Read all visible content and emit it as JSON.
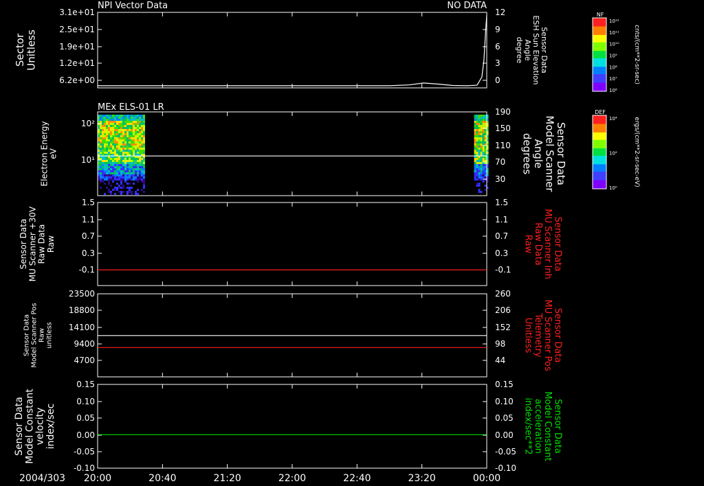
{
  "header": {
    "left_title": "NPI Vector Data",
    "right_title": "NO DATA"
  },
  "colors": {
    "white": "#ffffff",
    "red": "#ff2020",
    "green": "#00e000",
    "background": "#000000"
  },
  "colorbars": [
    {
      "tag": "NF",
      "ticks": [
        "10¹²",
        "10¹¹",
        "10¹⁰",
        "10⁹",
        "10⁸",
        "10⁷",
        "10⁶"
      ],
      "label": "cnts/(cm**2-sr-sec)"
    },
    {
      "tag": "DEF",
      "ticks": [
        "10⁴",
        "10²",
        "10⁰"
      ],
      "label": "ergs/(cm**2-sr-sec-eV)"
    }
  ],
  "chart_data": [
    {
      "type": "line",
      "title": "NPI Vector Data",
      "status": "NO DATA",
      "left_axis": {
        "label_lines": [
          "Sector",
          "Unitless"
        ],
        "ticks": [
          "3.1e+01",
          "2.5e+01",
          "1.9e+01",
          "1.2e+01",
          "6.2e+00"
        ],
        "ylim": [
          0,
          31
        ]
      },
      "right_axis": {
        "label_lines": [
          "Sensor Data",
          "ESH Sun Elevation",
          "Angle",
          "degree"
        ],
        "ticks": [
          "12",
          "9",
          "6",
          "3",
          "0"
        ],
        "ylim": [
          -2,
          12
        ]
      },
      "series": [
        {
          "axis": "right",
          "color": "#ffffff",
          "x": [
            0,
            3.0,
            3.2,
            3.35,
            3.5,
            3.65,
            3.8,
            3.9,
            3.95,
            3.97,
            3.99,
            4.0
          ],
          "y": [
            -1.6,
            -1.6,
            -1.45,
            -1.1,
            -1.3,
            -1.55,
            -1.6,
            -1.5,
            0,
            3,
            9,
            11.5
          ]
        }
      ]
    },
    {
      "type": "heatmap",
      "title": "MEx ELS-01 LR",
      "left_axis": {
        "label_lines": [
          "Electron Energy",
          "eV"
        ],
        "scale": "log",
        "ticks": [
          "10²",
          "10¹"
        ],
        "ylim": [
          1,
          200
        ]
      },
      "right_axis": {
        "label_lines": [
          "Sensor Data",
          "Model Scanner",
          "Angle",
          "degrees"
        ],
        "ticks": [
          "190",
          "150",
          "110",
          "70",
          "30"
        ],
        "ylim": [
          0,
          190
        ]
      },
      "data_blocks": [
        {
          "x_start": 0.0,
          "x_end": 0.48
        },
        {
          "x_start": 3.87,
          "x_end": 4.0
        }
      ],
      "series": [
        {
          "axis": "right",
          "color": "#ffffff",
          "x": [
            0,
            4
          ],
          "y": [
            90,
            90
          ]
        }
      ]
    },
    {
      "type": "line",
      "left_axis": {
        "label_lines": [
          "Sensor Data",
          "MU Scanner +30V",
          "Raw Data",
          "Raw"
        ],
        "ticks": [
          "1.5",
          "1.1",
          "0.7",
          "0.3",
          "-0.1"
        ],
        "ylim": [
          -0.35,
          1.5
        ]
      },
      "right_axis": {
        "label_lines": [
          "Sensor Data",
          "MU Scanner Inh",
          "Raw Data",
          "Raw"
        ],
        "ticks": [
          "1.5",
          "1.1",
          "0.7",
          "0.3",
          "-0.1"
        ],
        "ylim": [
          -0.35,
          1.5
        ]
      },
      "series": [
        {
          "axis": "left",
          "color": "#ff2020",
          "x": [
            0,
            4
          ],
          "y": [
            0.0,
            0.0
          ]
        }
      ]
    },
    {
      "type": "line",
      "left_axis": {
        "label_lines": [
          "Sensor Data",
          "Model Scanner Pos",
          "Raw",
          "unitless"
        ],
        "ticks": [
          "23500",
          "18800",
          "14100",
          "9400",
          "4700"
        ],
        "ylim": [
          0,
          23500
        ]
      },
      "right_axis": {
        "label_lines": [
          "Sensor Data",
          "MU Scanner Pos",
          "Telemetry",
          "Unitless"
        ],
        "ticks": [
          "260",
          "206",
          "152",
          "98",
          "44"
        ],
        "ylim": [
          -10,
          260
        ]
      },
      "series": [
        {
          "axis": "left",
          "color": "#ffffff",
          "x": [
            0,
            4
          ],
          "y": [
            11700,
            11700
          ]
        },
        {
          "axis": "left",
          "color": "#ff2020",
          "x": [
            0,
            4
          ],
          "y": [
            8300,
            8300
          ]
        }
      ]
    },
    {
      "type": "line",
      "left_axis": {
        "label_lines": [
          "Sensor Data",
          "Model Constant",
          "velocity",
          "index/sec"
        ],
        "ticks": [
          "0.15",
          "0.10",
          "0.05",
          "0.00",
          "-0.05",
          "-0.10"
        ],
        "ylim": [
          -0.1,
          0.15
        ]
      },
      "right_axis": {
        "label_lines": [
          "Sensor Data",
          "Model Constant",
          "acceleration",
          "index/sec**2"
        ],
        "ticks": [
          "0.15",
          "0.10",
          "0.05",
          "0.00",
          "-0.05",
          "-0.10"
        ],
        "ylim": [
          -0.1,
          0.15
        ]
      },
      "series": [
        {
          "axis": "left",
          "color": "#00e000",
          "x": [
            0,
            4
          ],
          "y": [
            0.0,
            0.0
          ]
        }
      ]
    }
  ],
  "x_axis": {
    "date_label": "2004/303",
    "ticks": [
      "20:00",
      "20:40",
      "21:20",
      "22:00",
      "22:40",
      "23:20",
      "00:00"
    ],
    "tick_hours": [
      0,
      0.6667,
      1.3333,
      2.0,
      2.6667,
      3.3333,
      4.0
    ],
    "range_hours": [
      0,
      4
    ]
  }
}
